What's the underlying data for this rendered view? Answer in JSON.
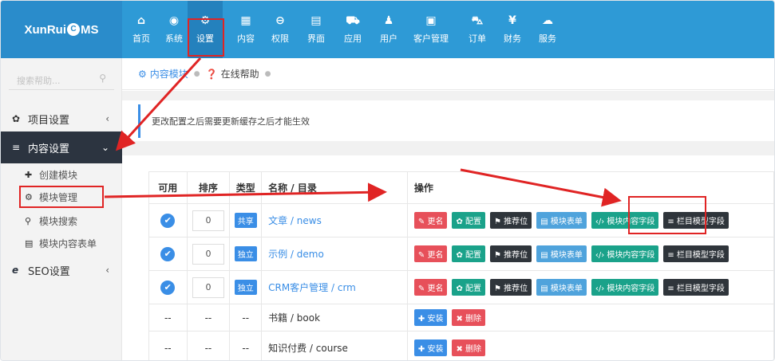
{
  "logo": {
    "text_left": "XunRui",
    "text_o": "C",
    "text_right": "MS"
  },
  "nav": [
    {
      "icon": "⌂",
      "label": "首页"
    },
    {
      "icon": "◉",
      "label": "系统"
    },
    {
      "icon": "⚙",
      "label": "设置"
    },
    {
      "icon": "▦",
      "label": "内容"
    },
    {
      "icon": "⊖",
      "label": "权限"
    },
    {
      "icon": "▤",
      "label": "界面"
    },
    {
      "icon": "⛟",
      "label": "应用"
    },
    {
      "icon": "♟",
      "label": "用户"
    },
    {
      "icon": "▣",
      "label": "客户管理"
    },
    {
      "icon": "⛍",
      "label": "订单"
    },
    {
      "icon": "¥",
      "label": "财务"
    },
    {
      "icon": "☁",
      "label": "服务"
    }
  ],
  "sidebar": {
    "search_placeholder": "搜索帮助...",
    "items": [
      {
        "icon": "✿",
        "label": "项目设置",
        "chev": "‹"
      },
      {
        "icon": "≡",
        "label": "内容设置",
        "chev": "⌄"
      },
      {
        "icon": "e",
        "label": "SEO设置",
        "chev": "‹"
      }
    ],
    "subitems": [
      {
        "icon": "✚",
        "label": "创建模块"
      },
      {
        "icon": "⚙",
        "label": "模块管理"
      },
      {
        "icon": "⚲",
        "label": "模块搜索"
      },
      {
        "icon": "▤",
        "label": "模块内容表单"
      }
    ]
  },
  "breadcrumb": {
    "item1": "内容模块",
    "item2": "在线帮助"
  },
  "notice": "更改配置之后需要更新缓存之后才能生效",
  "table": {
    "headers": [
      "可用",
      "排序",
      "类型",
      "名称 / 目录",
      "操作"
    ],
    "rows": [
      {
        "order": "0",
        "type": "共享",
        "name": "文章 / news",
        "installed": true
      },
      {
        "order": "0",
        "type": "独立",
        "name": "示例 / demo",
        "installed": true
      },
      {
        "order": "0",
        "type": "独立",
        "name": "CRM客户管理 / crm",
        "installed": true
      },
      {
        "dash": "--",
        "name": "书籍 / book",
        "installed": false
      },
      {
        "dash": "--",
        "name": "知识付费 / course",
        "installed": false
      }
    ],
    "ops": {
      "rename": "✎ 更名",
      "config": "✿ 配置",
      "recommend": "⚑ 推荐位",
      "form": "▤ 模块表单",
      "fields": "‹/› 模块内容字段",
      "catfield": "≡ 栏目模型字段"
    },
    "ops_uninstalled": {
      "install": "✚ 安装",
      "delete": "✖ 删除"
    }
  },
  "colors": {
    "topbar": "#2e9ad6",
    "accent": "#3a8ee6",
    "highlight": "#e02424"
  }
}
